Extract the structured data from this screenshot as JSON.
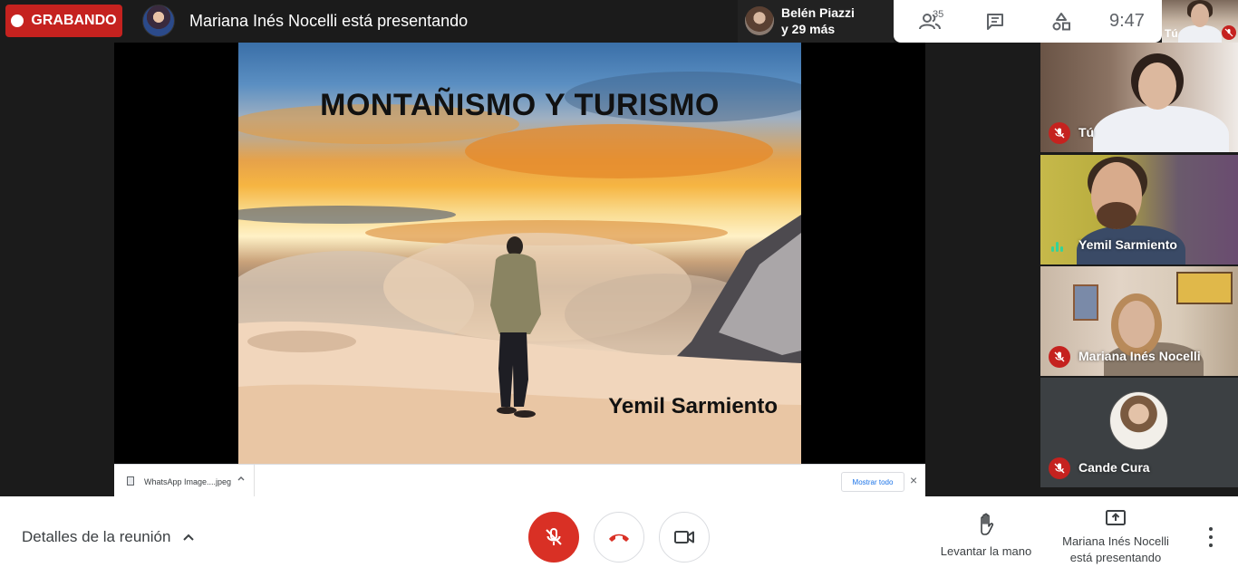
{
  "topbar": {
    "recording_label": "GRABANDO",
    "presenting_title": "Mariana Inés Nocelli está presentando",
    "participants_chip": {
      "name": "Belén Piazzi",
      "more": "y 29 más"
    },
    "people_count": "35",
    "clock": "9:47",
    "self_label": "Tú"
  },
  "slide": {
    "title": "MONTAÑISMO Y TURISMO",
    "author": "Yemil Sarmiento"
  },
  "download_bar": {
    "file_name": "WhatsApp Image....jpeg",
    "show_all": "Mostrar todo",
    "close": "×"
  },
  "tiles": [
    {
      "name": "Tú",
      "status": "muted"
    },
    {
      "name": "Yemil Sarmiento",
      "status": "speaking"
    },
    {
      "name": "Mariana Inés Nocelli",
      "status": "muted"
    },
    {
      "name": "Cande Cura",
      "status": "muted"
    }
  ],
  "bottombar": {
    "meeting_details": "Detalles de la reunión",
    "raise_hand": "Levantar la mano",
    "presenting_line1": "Mariana Inés Nocelli",
    "presenting_line2": "está presentando"
  },
  "colors": {
    "recording_red": "#c5221f",
    "mic_off_red": "#d93025",
    "speaking_green": "#34d399",
    "bar_white": "#ffffff"
  },
  "icons": {
    "people": "people-icon",
    "chat": "chat-icon",
    "activities": "activities-icon",
    "mic_off": "mic-off-icon",
    "hang_up": "phone-hangup-icon",
    "camera": "camera-icon",
    "raise_hand": "hand-icon",
    "present": "present-screen-icon",
    "more": "more-vert-icon"
  }
}
